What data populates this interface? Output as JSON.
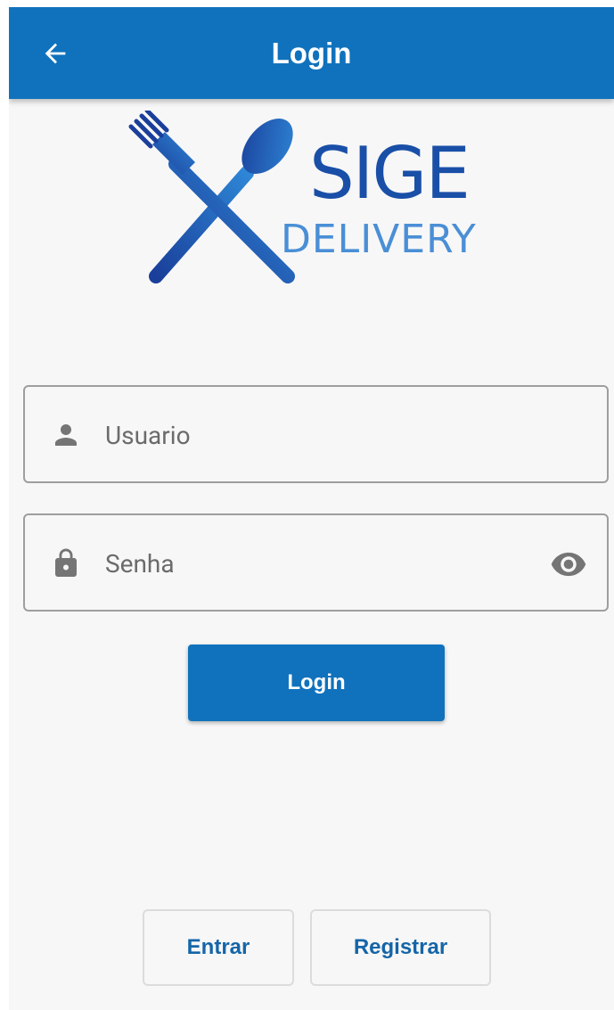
{
  "appbar": {
    "title": "Login",
    "back_icon": "arrow-left-icon",
    "background": "#1072bd"
  },
  "logo": {
    "line1": "SIGE",
    "line2": "DELIVERY",
    "icon": "fork-and-spoon-crossed-icon"
  },
  "form": {
    "username": {
      "placeholder": "Usuario",
      "value": "",
      "icon": "person-icon"
    },
    "password": {
      "placeholder": "Senha",
      "value": "",
      "icon": "lock-icon",
      "toggle_icon": "eye-icon"
    },
    "login_label": "Login"
  },
  "footer": {
    "entrar_label": "Entrar",
    "registrar_label": "Registrar"
  },
  "colors": {
    "primary": "#1072bd",
    "link": "#1565a8",
    "background": "#f7f7f7"
  }
}
